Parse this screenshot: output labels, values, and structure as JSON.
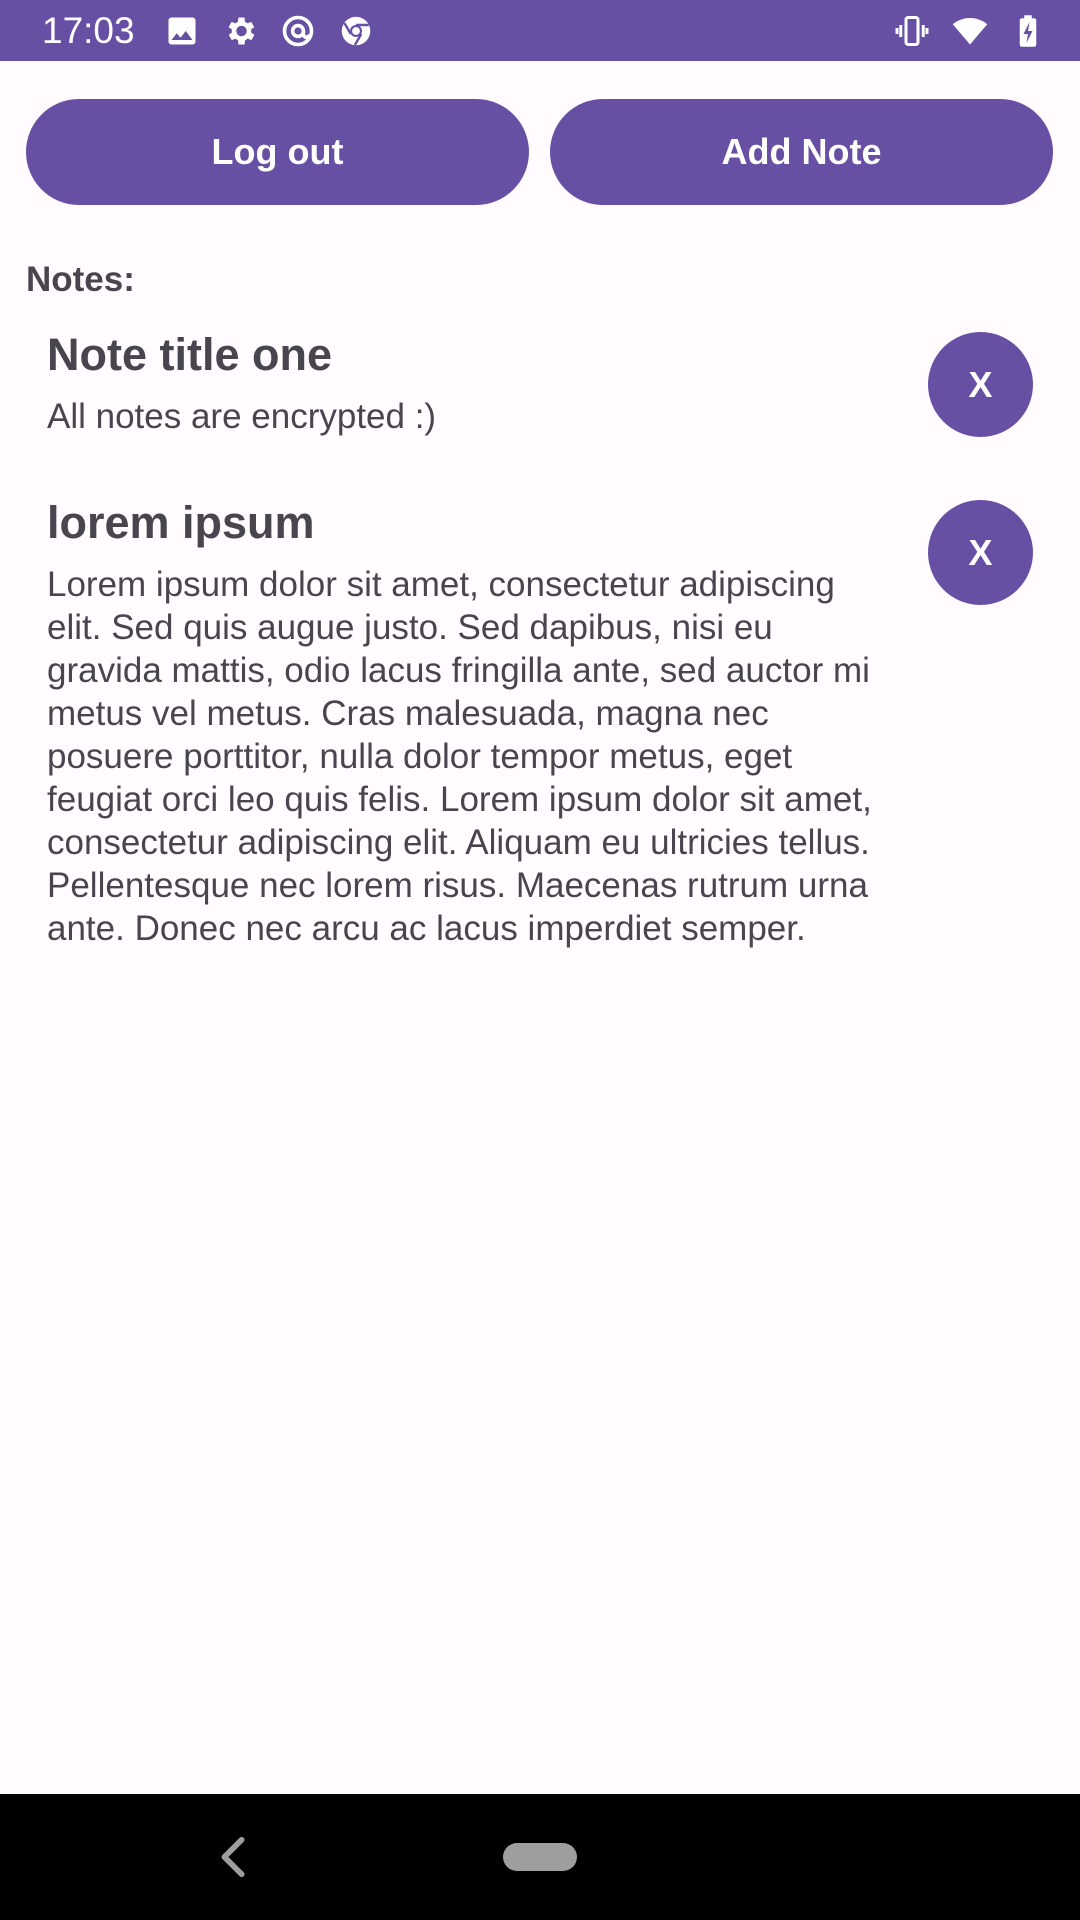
{
  "status_bar": {
    "time": "17:03",
    "left_icons": [
      "image-icon",
      "gear-icon",
      "at-sign-icon",
      "chrome-icon"
    ],
    "right_icons": [
      "vibrate-icon",
      "wifi-icon",
      "battery-charging-icon"
    ]
  },
  "toolbar": {
    "logout_label": "Log out",
    "add_note_label": "Add Note"
  },
  "notes_heading": "Notes:",
  "notes": [
    {
      "title": "Note title one",
      "body": "All notes are encrypted :)",
      "delete_label": "X"
    },
    {
      "title": "lorem ipsum",
      "body": "Lorem ipsum dolor sit amet, consectetur adipiscing elit. Sed quis augue justo. Sed dapibus, nisi eu gravida mattis, odio lacus fringilla ante, sed auctor mi metus vel metus. Cras malesuada, magna nec posuere porttitor, nulla dolor tempor metus, eget feugiat orci leo quis felis. Lorem ipsum dolor sit amet, consectetur adipiscing elit. Aliquam eu ultricies tellus. Pellentesque nec lorem risus. Maecenas rutrum urna ante. Donec nec arcu ac lacus imperdiet semper.",
      "delete_label": "X"
    }
  ],
  "colors": {
    "primary": "#6750a4",
    "on_primary": "#ffffff",
    "background": "#fffbfe",
    "text": "#49454f"
  },
  "nav_bar": {
    "back_icon": "back-chevron-icon",
    "home_icon": "home-pill-icon"
  }
}
